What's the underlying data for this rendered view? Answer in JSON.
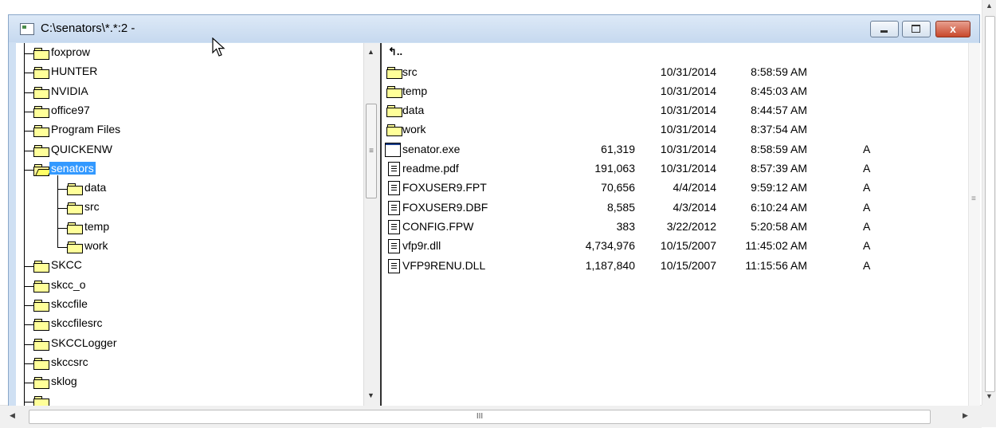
{
  "window": {
    "title": "C:\\senators\\*.*:2 -",
    "close_label": "x"
  },
  "tree": {
    "items": [
      {
        "label": "foxprow",
        "level": 0,
        "connector": "tee"
      },
      {
        "label": "HUNTER",
        "level": 0,
        "connector": "tee"
      },
      {
        "label": "NVIDIA",
        "level": 0,
        "connector": "tee"
      },
      {
        "label": "office97",
        "level": 0,
        "connector": "tee"
      },
      {
        "label": "Program Files",
        "level": 0,
        "connector": "tee"
      },
      {
        "label": "QUICKENW",
        "level": 0,
        "connector": "tee"
      },
      {
        "label": "senators",
        "level": 0,
        "connector": "tee",
        "selected": true,
        "open": true
      },
      {
        "label": "data",
        "level": 1,
        "connector": "tee"
      },
      {
        "label": "src",
        "level": 1,
        "connector": "tee"
      },
      {
        "label": "temp",
        "level": 1,
        "connector": "tee"
      },
      {
        "label": "work",
        "level": 1,
        "connector": "end"
      },
      {
        "label": "SKCC",
        "level": 0,
        "connector": "tee"
      },
      {
        "label": "skcc_o",
        "level": 0,
        "connector": "tee"
      },
      {
        "label": "skccfile",
        "level": 0,
        "connector": "tee"
      },
      {
        "label": "skccfilesrc",
        "level": 0,
        "connector": "tee"
      },
      {
        "label": "SKCCLogger",
        "level": 0,
        "connector": "tee"
      },
      {
        "label": "skccsrc",
        "level": 0,
        "connector": "tee"
      },
      {
        "label": "sklog",
        "level": 0,
        "connector": "tee"
      },
      {
        "label": "",
        "level": 0,
        "connector": "tee"
      }
    ]
  },
  "files": {
    "up_label": "↰..",
    "rows": [
      {
        "name": "src",
        "type": "folder",
        "size": "",
        "date": "10/31/2014",
        "time": "8:58:59 AM",
        "attr": ""
      },
      {
        "name": "temp",
        "type": "folder",
        "size": "",
        "date": "10/31/2014",
        "time": "8:45:03 AM",
        "attr": ""
      },
      {
        "name": "data",
        "type": "folder",
        "size": "",
        "date": "10/31/2014",
        "time": "8:44:57 AM",
        "attr": ""
      },
      {
        "name": "work",
        "type": "folder",
        "size": "",
        "date": "10/31/2014",
        "time": "8:37:54 AM",
        "attr": ""
      },
      {
        "name": "senator.exe",
        "type": "exe",
        "size": "61,319",
        "date": "10/31/2014",
        "time": "8:58:59 AM",
        "attr": "A"
      },
      {
        "name": "readme.pdf",
        "type": "doc",
        "size": "191,063",
        "date": "10/31/2014",
        "time": "8:57:39 AM",
        "attr": "A"
      },
      {
        "name": "FOXUSER9.FPT",
        "type": "doc",
        "size": "70,656",
        "date": "4/4/2014",
        "time": "9:59:12 AM",
        "attr": "A"
      },
      {
        "name": "FOXUSER9.DBF",
        "type": "doc",
        "size": "8,585",
        "date": "4/3/2014",
        "time": "6:10:24 AM",
        "attr": "A"
      },
      {
        "name": "CONFIG.FPW",
        "type": "doc",
        "size": "383",
        "date": "3/22/2012",
        "time": "5:20:58 AM",
        "attr": "A"
      },
      {
        "name": "vfp9r.dll",
        "type": "doc",
        "size": "4,734,976",
        "date": "10/15/2007",
        "time": "11:45:02 AM",
        "attr": "A"
      },
      {
        "name": "VFP9RENU.DLL",
        "type": "doc",
        "size": "1,187,840",
        "date": "10/15/2007",
        "time": "11:15:56 AM",
        "attr": "A"
      }
    ]
  },
  "scrollbars": {
    "grip": "≡",
    "h_grip": "III",
    "up": "▲",
    "down": "▼",
    "left": "◀",
    "right": "▶"
  },
  "icons": {
    "folder": "folder-icon",
    "open_folder": "open-folder-icon",
    "document": "document-icon",
    "executable": "executable-icon",
    "cursor": "mouse-pointer-icon"
  },
  "colors": {
    "selection": "#3399ff",
    "folder_fill": "#ffff99",
    "titlebar": "#c6d9ef",
    "close_button": "#c8482c"
  }
}
